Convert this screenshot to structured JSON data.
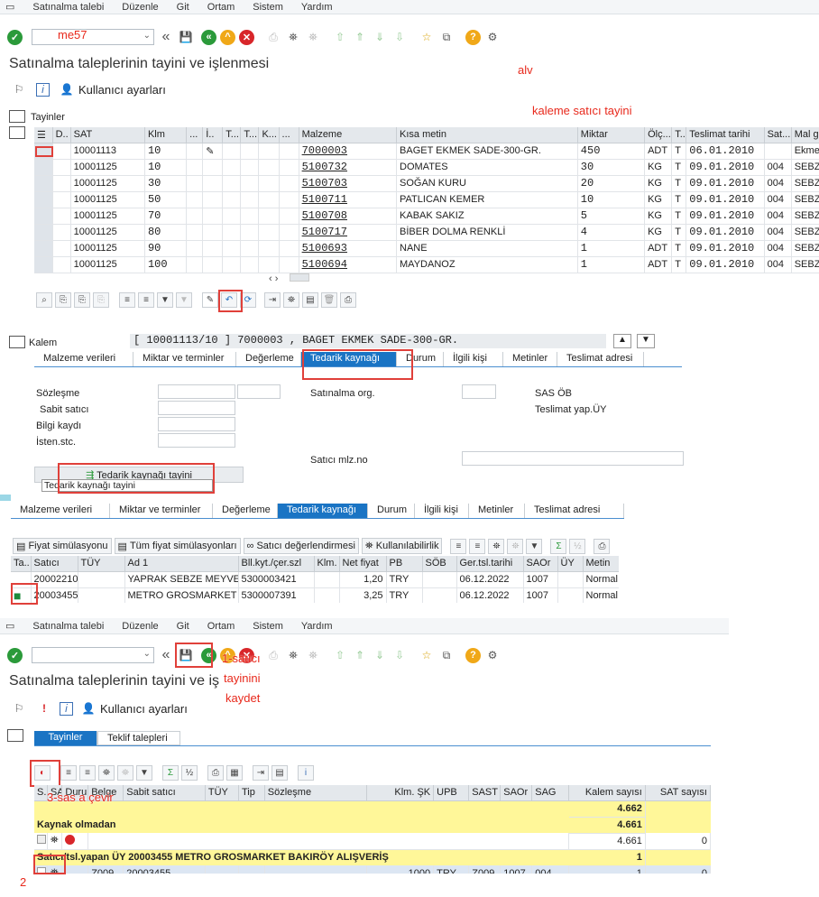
{
  "menu1": [
    "Satınalma talebi",
    "Düzenle",
    "Git",
    "Ortam",
    "Sistem",
    "Yardım"
  ],
  "menu2": [
    "Satınalma talebi",
    "Düzenle",
    "Git",
    "Ortam",
    "Sistem",
    "Yardım"
  ],
  "tcode_value": "me57",
  "title1": "Satınalma taleplerinin tayini ve işlenmesi",
  "title2": "Satınalma taleplerinin tayini ve işlenmesi",
  "user_settings": "Kullanıcı ayarları",
  "annotations": {
    "alv": "alv",
    "kaleme": "kaleme satıcı tayini",
    "step1a": "1-satıcı",
    "step1b": "tayinini",
    "step1c": "kaydet",
    "step2": "2",
    "step3": "3-sas a çevir"
  },
  "assign_label": "Tayinler",
  "grid1": {
    "headers": [
      "D..",
      "SAT",
      "Klm",
      "...",
      "İ..",
      "T...",
      "T...",
      "K...",
      "...",
      "Malzeme",
      "Kısa metin",
      "Miktar",
      "Ölç...",
      "T..",
      "Teslimat tarihi",
      "Sat...",
      "Mal grup"
    ],
    "rows": [
      [
        "",
        "10001113",
        "10",
        "",
        "✎",
        "",
        "",
        "",
        "",
        "7000003",
        "BAGET EKMEK SADE-300-GR.",
        "450",
        "ADT",
        "T",
        "06.01.2010",
        "",
        "Ekmek"
      ],
      [
        "",
        "10001125",
        "10",
        "",
        "",
        "",
        "",
        "",
        "",
        "5100732",
        "DOMATES",
        "30",
        "KG",
        "T",
        "09.01.2010",
        "004",
        "SEBZE"
      ],
      [
        "",
        "10001125",
        "30",
        "",
        "",
        "",
        "",
        "",
        "",
        "5100703",
        "SOĞAN KURU",
        "20",
        "KG",
        "T",
        "09.01.2010",
        "004",
        "SEBZE"
      ],
      [
        "",
        "10001125",
        "50",
        "",
        "",
        "",
        "",
        "",
        "",
        "5100711",
        "PATLICAN KEMER",
        "10",
        "KG",
        "T",
        "09.01.2010",
        "004",
        "SEBZE"
      ],
      [
        "",
        "10001125",
        "70",
        "",
        "",
        "",
        "",
        "",
        "",
        "5100708",
        "KABAK SAKIZ",
        "5",
        "KG",
        "T",
        "09.01.2010",
        "004",
        "SEBZE"
      ],
      [
        "",
        "10001125",
        "80",
        "",
        "",
        "",
        "",
        "",
        "",
        "5100717",
        "BİBER DOLMA RENKLİ",
        "4",
        "KG",
        "T",
        "09.01.2010",
        "004",
        "SEBZE"
      ],
      [
        "",
        "10001125",
        "90",
        "",
        "",
        "",
        "",
        "",
        "",
        "5100693",
        "NANE",
        "1",
        "ADT",
        "T",
        "09.01.2010",
        "004",
        "SEBZE"
      ],
      [
        "",
        "10001125",
        "100",
        "",
        "",
        "",
        "",
        "",
        "",
        "5100694",
        "MAYDANOZ",
        "1",
        "ADT",
        "T",
        "09.01.2010",
        "004",
        "SEBZE"
      ]
    ]
  },
  "kalem": {
    "label": "Kalem",
    "value": "[ 10001113/10 ] 7000003 , BAGET EKMEK SADE-300-GR."
  },
  "tabs1": [
    "Malzeme verileri",
    "Miktar ve terminler",
    "Değerleme",
    "Tedarik kaynağı",
    "Durum",
    "İlgili kişi",
    "Metinler",
    "Teslimat adresi"
  ],
  "tabs2": [
    "Malzeme verileri",
    "Miktar ve terminler",
    "Değerleme",
    "Tedarik kaynağı",
    "Durum",
    "İlgili kişi",
    "Metinler",
    "Teslimat adresi"
  ],
  "form": {
    "sozlesme": "Sözleşme",
    "sabit": "Sabit satıcı",
    "bilgi": "Bilgi kaydı",
    "isten": "İsten.stc.",
    "satorg": "Satınalma org.",
    "sasob": "SAS ÖB",
    "teslimat": "Teslimat yap.ÜY",
    "saticimlz": "Satıcı mlz.no",
    "tedarik_btn": "Tedarik kaynağı tayini",
    "tedarik_tip": "Tedarik kaynağı tayini"
  },
  "grid2_buttons": [
    "Fiyat simülasyonu",
    "Tüm fiyat simülasyonları",
    "Satıcı değerlendirmesi",
    "Kullanılabilirlik"
  ],
  "grid2": {
    "headers": [
      "Ta..",
      "Satıcı",
      "TÜY",
      "Ad 1",
      "Bll.kyt./çer.szl",
      "Klm.",
      "Net fiyat",
      "PB",
      "SÖB",
      "Ger.tsl.tarihi",
      "SAOr",
      "ÜY",
      "Metin"
    ],
    "rows": [
      [
        "",
        "20002210",
        "",
        "YAPRAK SEBZE MEYVE",
        "5300003421",
        "",
        "1,20",
        "TRY",
        "",
        "06.12.2022",
        "1007",
        "",
        "Normal"
      ],
      [
        "■",
        "20003455",
        "",
        "METRO GROSMARKET",
        "5300007391",
        "",
        "3,25",
        "TRY",
        "",
        "06.12.2022",
        "1007",
        "",
        "Normal"
      ]
    ]
  },
  "tabs3": [
    "Tayinler",
    "Teklif talepleri"
  ],
  "grid3": {
    "headers": [
      "S..",
      "SAT",
      "Durum",
      "Belge",
      "Sabit satıcı",
      "TÜY",
      "Tip",
      "Sözleşme",
      "Klm. ŞK",
      "UPB",
      "SAST",
      "SAOr",
      "SAG",
      "Kalem sayısı",
      "SAT sayısı"
    ],
    "total_row": "4.662",
    "group1": {
      "label": "Kaynak olmadan",
      "value": "4.661"
    },
    "row1": {
      "kalem": "4.661",
      "sat": "0"
    },
    "group2": {
      "label": "Satıcı/tsl.yapan ÜY 20003455 METRO GROSMARKET BAKIRÖY ALIŞVERİŞ",
      "value": "1"
    },
    "row2": {
      "belge": "Z009",
      "sabit": "20003455",
      "klm": "1000",
      "upb": "TRY",
      "sast": "Z009",
      "saor": "1007",
      "sag": "004",
      "kalem": "1",
      "sat": "0"
    }
  }
}
